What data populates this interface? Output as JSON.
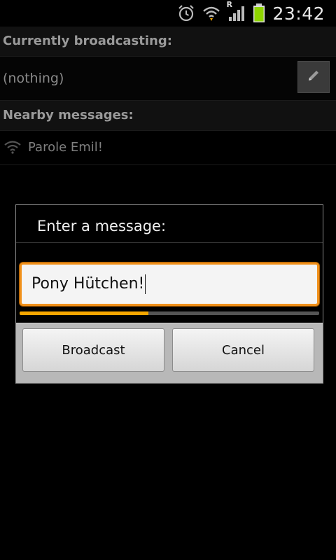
{
  "status_bar": {
    "time": "23:42",
    "roaming_indicator": "R",
    "icons": [
      "alarm-icon",
      "wifi-icon",
      "signal-icon",
      "battery-icon"
    ]
  },
  "app": {
    "current_header": "Currently broadcasting:",
    "current_value": "(nothing)",
    "edit_icon": "pencil-icon",
    "nearby_header": "Nearby messages:",
    "nearby_messages": [
      {
        "icon": "wifi-icon",
        "text": "Parole Emil!"
      }
    ]
  },
  "dialog": {
    "title": "Enter a message:",
    "input_value": "Pony Hütchen!",
    "progress_fraction": 0.43,
    "buttons": {
      "broadcast": "Broadcast",
      "cancel": "Cancel"
    }
  },
  "colors": {
    "accent_orange": "#f0901a",
    "progress_yellow": "#f6a700",
    "battery_green": "#8fd400"
  }
}
